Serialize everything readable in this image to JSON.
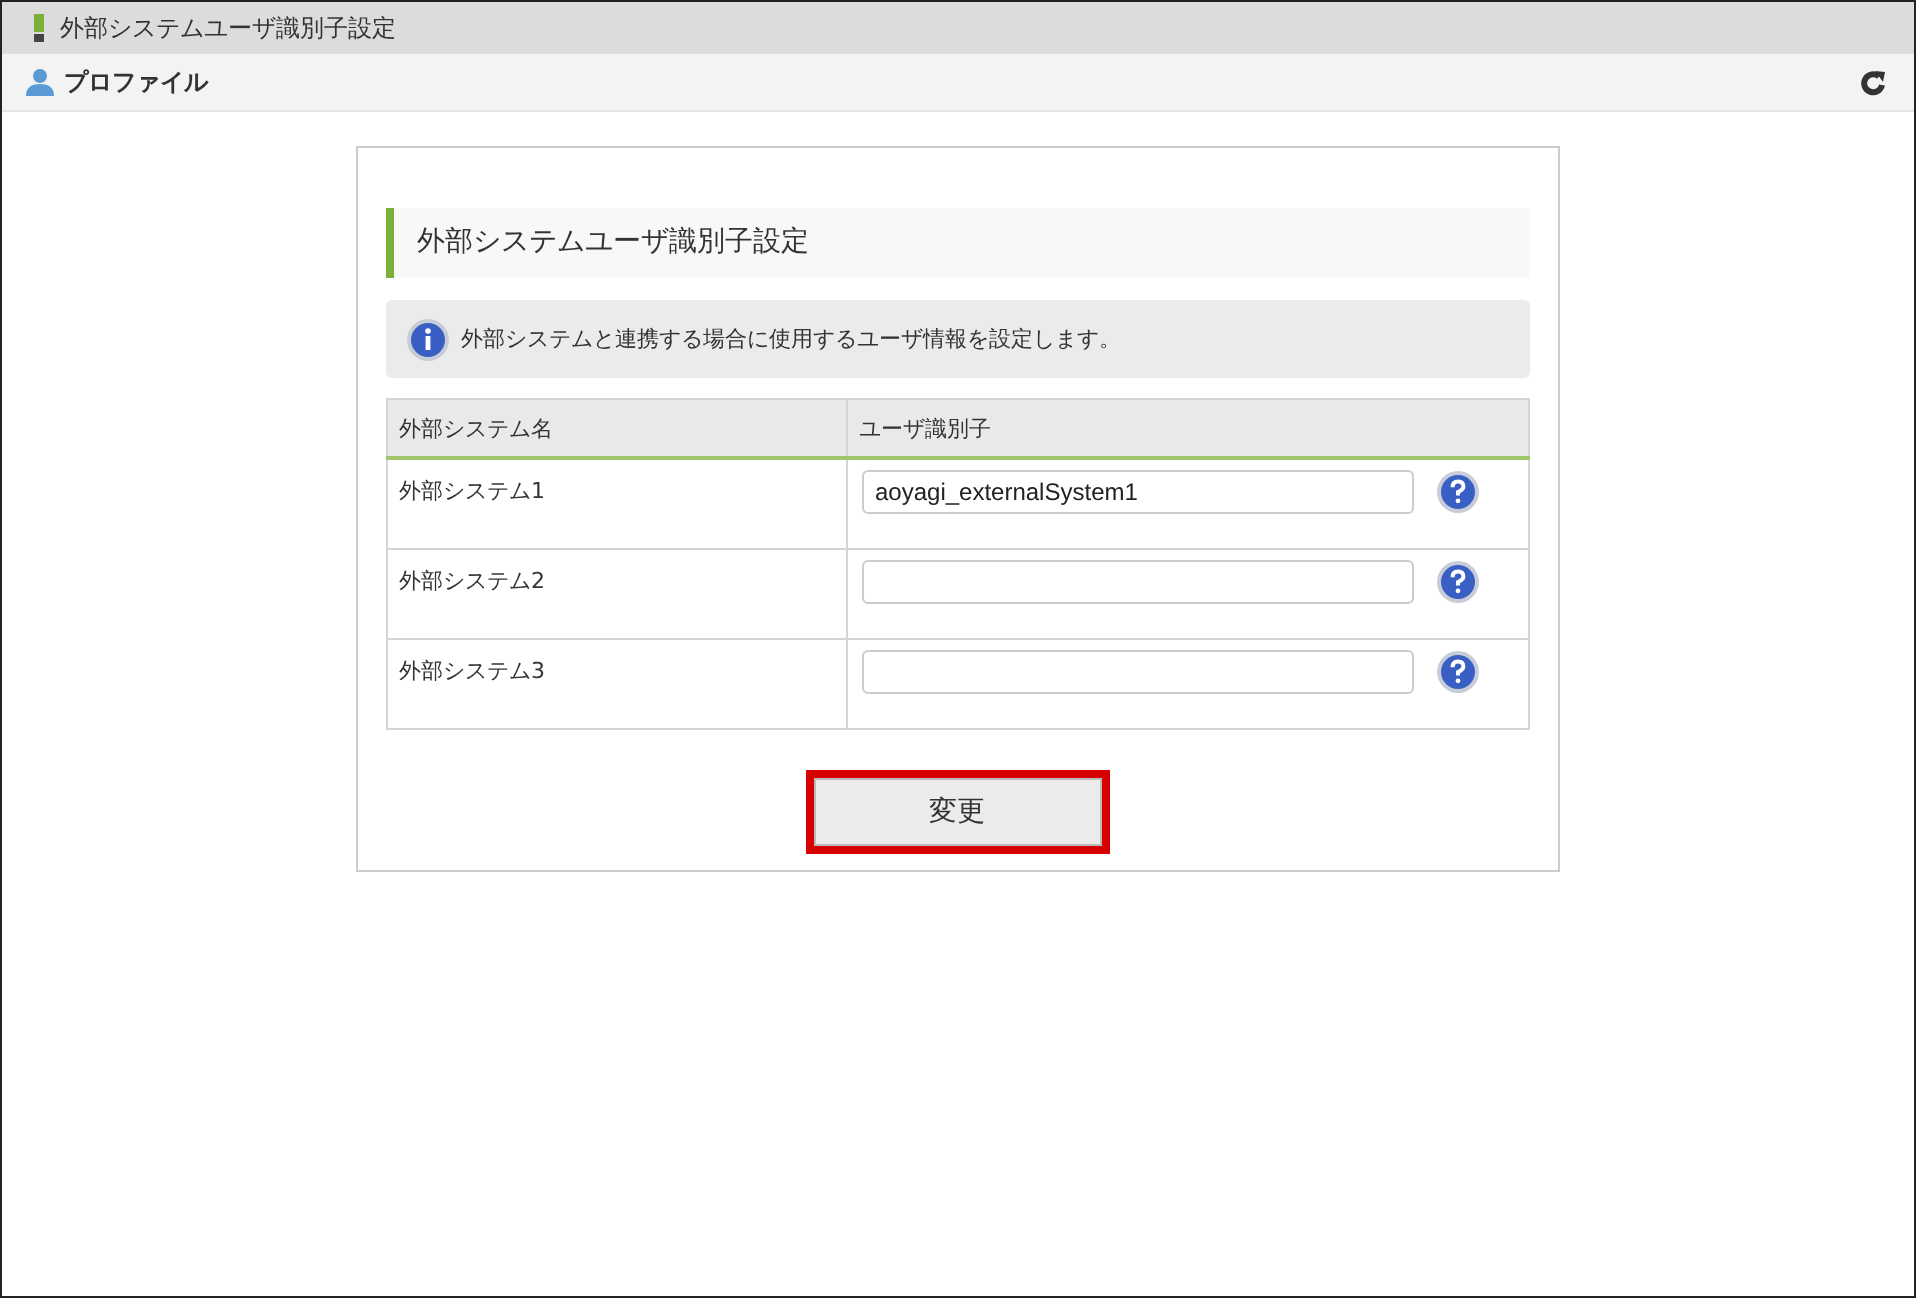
{
  "window": {
    "title": "外部システムユーザ識別子設定"
  },
  "header": {
    "label": "プロファイル"
  },
  "panel": {
    "title": "外部システムユーザ識別子設定",
    "info": "外部システムと連携する場合に使用するユーザ情報を設定します。"
  },
  "table": {
    "columns": [
      "外部システム名",
      "ユーザ識別子"
    ],
    "rows": [
      {
        "name": "外部システム1",
        "value": "aoyagi_externalSystem1"
      },
      {
        "name": "外部システム2"
      },
      {
        "name": "外部システム3"
      }
    ]
  },
  "submit": {
    "label": "変更",
    "highlighted": true
  }
}
